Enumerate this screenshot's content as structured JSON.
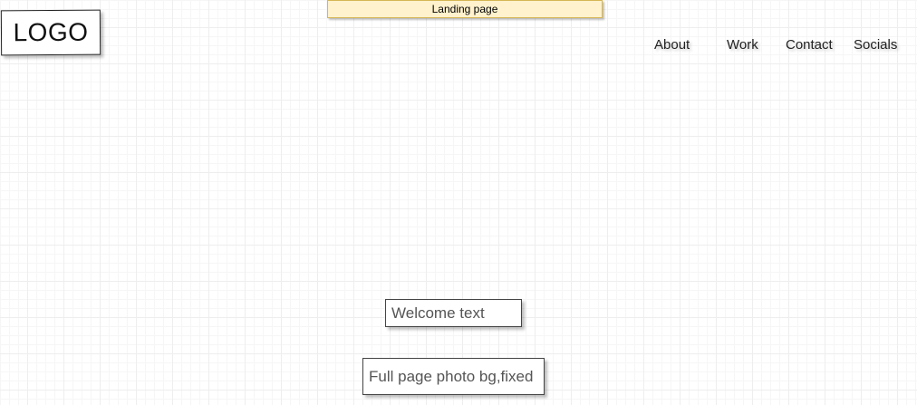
{
  "page_note": "Landing page",
  "logo": {
    "text": "LOGO"
  },
  "nav": {
    "items": [
      {
        "label": "About"
      },
      {
        "label": "Work"
      },
      {
        "label": "Contact"
      },
      {
        "label": "Socials"
      }
    ]
  },
  "hero": {
    "welcome_text": "Welcome text",
    "background_note": "Full page photo bg,fixed"
  },
  "colors": {
    "note_fill": "#fff2cc",
    "note_border": "#d6b656",
    "grid_line": "#eeeeee",
    "box_border": "#444444"
  }
}
